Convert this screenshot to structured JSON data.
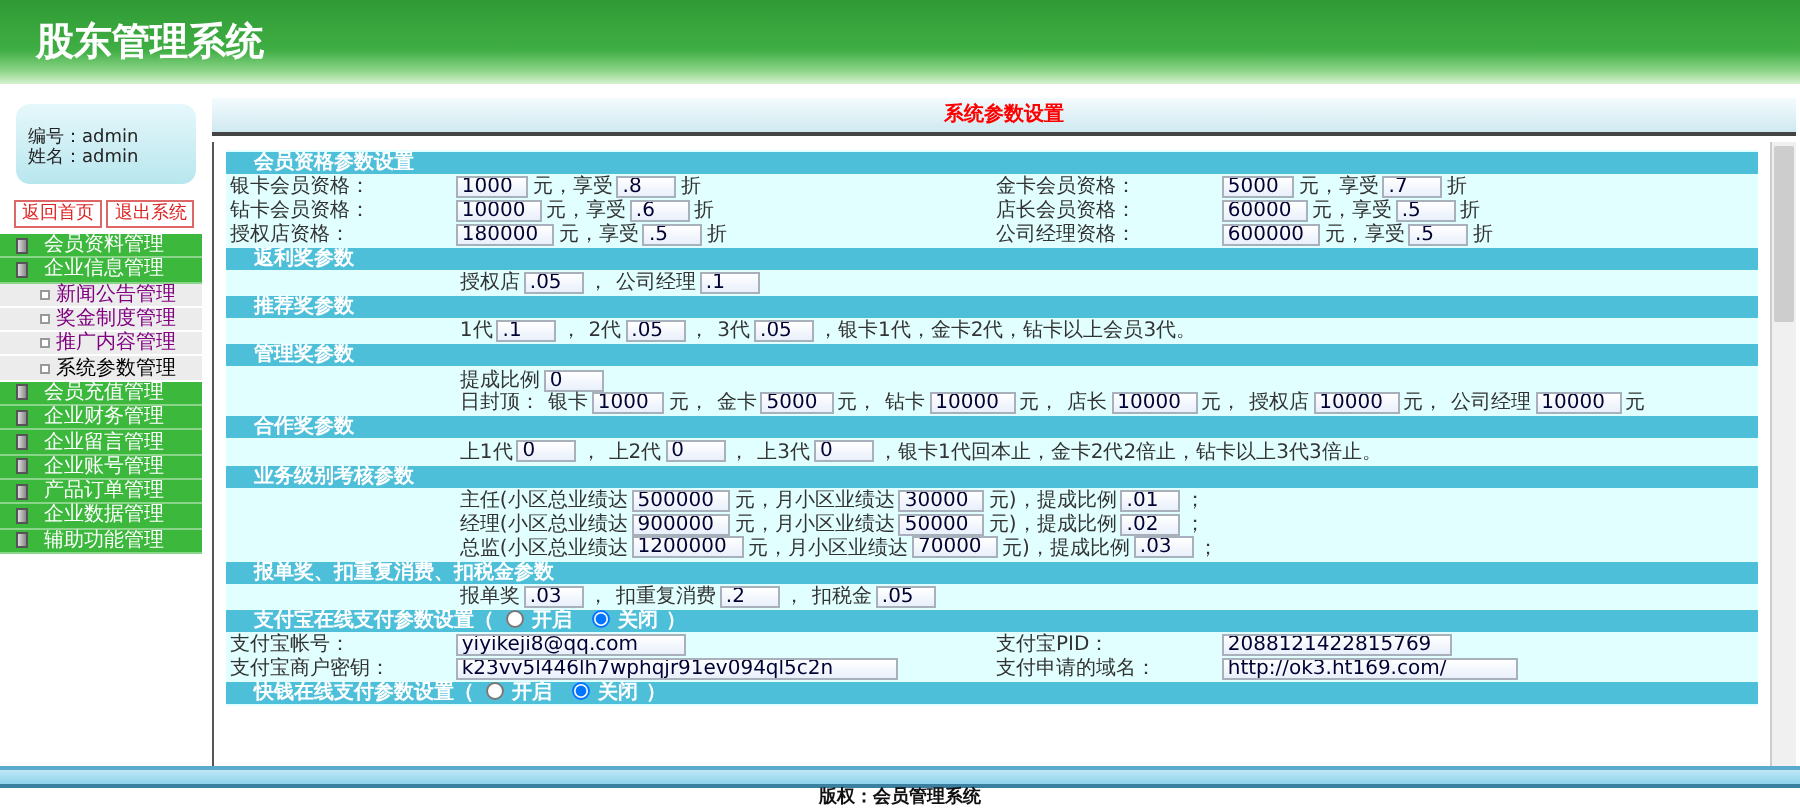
{
  "header": {
    "title": "股东管理系统"
  },
  "sidebar": {
    "user": [
      "编号：admin",
      "姓名：admin"
    ],
    "buttons": [
      "返回首页",
      "退出系统"
    ],
    "menu": [
      {
        "label": "会员资料管理"
      },
      {
        "label": "企业信息管理",
        "children": [
          {
            "label": "新闻公告管理",
            "visited": true
          },
          {
            "label": "奖金制度管理",
            "visited": true
          },
          {
            "label": "推广内容管理",
            "visited": true
          },
          {
            "label": "系统参数管理",
            "visited": false
          }
        ]
      },
      {
        "label": "会员充值管理"
      },
      {
        "label": "企业财务管理"
      },
      {
        "label": "企业留言管理"
      },
      {
        "label": "企业账号管理"
      },
      {
        "label": "产品订单管理"
      },
      {
        "label": "企业数据管理"
      },
      {
        "label": "辅助功能管理"
      }
    ]
  },
  "main": {
    "title": "系统参数设置",
    "sections": [
      {
        "title": "会员资格参数设置",
        "rows": [
          {
            "kind": "pair",
            "cells": [
              {
                "label": "银卡会员资格：",
                "parts": [
                  {
                    "kind": "field",
                    "value": "1000"
                  },
                  {
                    "kind": "text",
                    "text": "元，享受"
                  },
                  {
                    "kind": "field",
                    "value": ".8"
                  },
                  {
                    "kind": "text",
                    "text": "折"
                  }
                ]
              },
              {
                "label": "金卡会员资格：",
                "parts": [
                  {
                    "kind": "field",
                    "value": "5000"
                  },
                  {
                    "kind": "text",
                    "text": "元，享受"
                  },
                  {
                    "kind": "field",
                    "value": ".7"
                  },
                  {
                    "kind": "text",
                    "text": "折"
                  }
                ]
              }
            ]
          },
          {
            "kind": "pair",
            "cells": [
              {
                "label": "钻卡会员资格：",
                "parts": [
                  {
                    "kind": "field",
                    "value": "10000"
                  },
                  {
                    "kind": "text",
                    "text": "元，享受"
                  },
                  {
                    "kind": "field",
                    "value": ".6"
                  },
                  {
                    "kind": "text",
                    "text": "折"
                  }
                ]
              },
              {
                "label": "店长会员资格：",
                "parts": [
                  {
                    "kind": "field",
                    "value": "60000"
                  },
                  {
                    "kind": "text",
                    "text": "元，享受"
                  },
                  {
                    "kind": "field",
                    "value": ".5"
                  },
                  {
                    "kind": "text",
                    "text": "折"
                  }
                ]
              }
            ]
          },
          {
            "kind": "pair",
            "cells": [
              {
                "label": "授权店资格：",
                "parts": [
                  {
                    "kind": "field",
                    "value": "180000"
                  },
                  {
                    "kind": "text",
                    "text": "元，享受"
                  },
                  {
                    "kind": "field",
                    "value": ".5"
                  },
                  {
                    "kind": "text",
                    "text": "折"
                  }
                ]
              },
              {
                "label": "公司经理资格：",
                "parts": [
                  {
                    "kind": "field",
                    "value": "600000"
                  },
                  {
                    "kind": "text",
                    "text": "元，享受"
                  },
                  {
                    "kind": "field",
                    "value": ".5"
                  },
                  {
                    "kind": "text",
                    "text": "折"
                  }
                ]
              }
            ]
          }
        ]
      },
      {
        "title": "返利奖参数",
        "rows": [
          {
            "kind": "line",
            "parts": [
              {
                "kind": "text",
                "text": "授权店"
              },
              {
                "kind": "field",
                "value": ".05"
              },
              {
                "kind": "text",
                "text": "，"
              },
              {
                "kind": "text",
                "text": "公司经理"
              },
              {
                "kind": "field",
                "value": ".1"
              }
            ]
          }
        ]
      },
      {
        "title": "推荐奖参数",
        "rows": [
          {
            "kind": "line",
            "parts": [
              {
                "kind": "text",
                "text": "1代"
              },
              {
                "kind": "field",
                "value": ".1"
              },
              {
                "kind": "text",
                "text": "，"
              },
              {
                "kind": "text",
                "text": "2代"
              },
              {
                "kind": "field",
                "value": ".05"
              },
              {
                "kind": "text",
                "text": "，"
              },
              {
                "kind": "text",
                "text": "3代"
              },
              {
                "kind": "field",
                "value": ".05"
              },
              {
                "kind": "text",
                "text": "，银卡1代，金卡2代，钻卡以上会员3代。"
              }
            ]
          }
        ]
      },
      {
        "title": "管理奖参数",
        "rows": [
          {
            "kind": "line",
            "parts": [
              {
                "kind": "text",
                "text": "提成比例"
              },
              {
                "kind": "field",
                "value": "0"
              }
            ]
          },
          {
            "kind": "line",
            "parts": [
              {
                "kind": "text",
                "text": "日封顶："
              },
              {
                "kind": "text",
                "text": "银卡"
              },
              {
                "kind": "field",
                "value": "1000"
              },
              {
                "kind": "text",
                "text": "元，"
              },
              {
                "kind": "text",
                "text": "金卡"
              },
              {
                "kind": "field",
                "value": "5000"
              },
              {
                "kind": "text",
                "text": "元，"
              },
              {
                "kind": "text",
                "text": "钻卡"
              },
              {
                "kind": "field",
                "value": "10000"
              },
              {
                "kind": "text",
                "text": "元，"
              },
              {
                "kind": "text",
                "text": "店长"
              },
              {
                "kind": "field",
                "value": "10000"
              },
              {
                "kind": "text",
                "text": "元，"
              },
              {
                "kind": "text",
                "text": "授权店"
              },
              {
                "kind": "field",
                "value": "10000"
              },
              {
                "kind": "text",
                "text": "元，"
              },
              {
                "kind": "text",
                "text": "公司经理"
              },
              {
                "kind": "field",
                "value": "10000"
              },
              {
                "kind": "text",
                "text": "元"
              }
            ]
          }
        ]
      },
      {
        "title": "合作奖参数",
        "rows": [
          {
            "kind": "line",
            "parts": [
              {
                "kind": "text",
                "text": "上1代"
              },
              {
                "kind": "field",
                "value": "0"
              },
              {
                "kind": "text",
                "text": "，"
              },
              {
                "kind": "text",
                "text": "上2代"
              },
              {
                "kind": "field",
                "value": "0"
              },
              {
                "kind": "text",
                "text": "，"
              },
              {
                "kind": "text",
                "text": "上3代"
              },
              {
                "kind": "field",
                "value": "0"
              },
              {
                "kind": "text",
                "text": "，银卡1代回本止，金卡2代2倍止，钻卡以上3代3倍止。"
              }
            ]
          }
        ]
      },
      {
        "title": "业务级别考核参数",
        "rows": [
          {
            "kind": "line",
            "parts": [
              {
                "kind": "text",
                "text": "主任(小区总业绩达"
              },
              {
                "kind": "field",
                "value": "500000"
              },
              {
                "kind": "text",
                "text": "元，月小区业绩达"
              },
              {
                "kind": "field",
                "value": "30000"
              },
              {
                "kind": "text",
                "text": "元)，提成比例"
              },
              {
                "kind": "field",
                "value": ".01"
              },
              {
                "kind": "text",
                "text": "；"
              }
            ]
          },
          {
            "kind": "line",
            "parts": [
              {
                "kind": "text",
                "text": "经理(小区总业绩达"
              },
              {
                "kind": "field",
                "value": "900000"
              },
              {
                "kind": "text",
                "text": "元，月小区业绩达"
              },
              {
                "kind": "field",
                "value": "50000"
              },
              {
                "kind": "text",
                "text": "元)，提成比例"
              },
              {
                "kind": "field",
                "value": ".02"
              },
              {
                "kind": "text",
                "text": "；"
              }
            ]
          },
          {
            "kind": "line",
            "parts": [
              {
                "kind": "text",
                "text": "总监(小区总业绩达"
              },
              {
                "kind": "field",
                "value": "1200000"
              },
              {
                "kind": "text",
                "text": "元，月小区业绩达"
              },
              {
                "kind": "field",
                "value": "70000"
              },
              {
                "kind": "text",
                "text": "元)，提成比例"
              },
              {
                "kind": "field",
                "value": ".03"
              },
              {
                "kind": "text",
                "text": "；"
              }
            ]
          }
        ]
      },
      {
        "title": "报单奖、扣重复消费、扣税金参数",
        "rows": [
          {
            "kind": "line",
            "parts": [
              {
                "kind": "text",
                "text": "报单奖"
              },
              {
                "kind": "field",
                "value": ".03"
              },
              {
                "kind": "text",
                "text": "，"
              },
              {
                "kind": "text",
                "text": "扣重复消费"
              },
              {
                "kind": "field",
                "value": ".2"
              },
              {
                "kind": "text",
                "text": "，"
              },
              {
                "kind": "text",
                "text": "扣税金"
              },
              {
                "kind": "field",
                "value": ".05"
              }
            ]
          }
        ]
      },
      {
        "title": "支付宝在线支付参数设置（",
        "radios": [
          {
            "label": "开启",
            "selected": false
          },
          {
            "label": "关闭",
            "selected": true
          }
        ],
        "title_end": "）",
        "rows": [
          {
            "kind": "pair",
            "cells": [
              {
                "label": "支付宝帐号：",
                "parts": [
                  {
                    "kind": "field",
                    "value": "yiyikeji8@qq.com"
                  }
                ]
              },
              {
                "label": "支付宝PID：",
                "parts": [
                  {
                    "kind": "field",
                    "value": "2088121422815769"
                  }
                ]
              }
            ]
          },
          {
            "kind": "pair",
            "cells": [
              {
                "label": "支付宝商户密钥：",
                "parts": [
                  {
                    "kind": "field",
                    "value": "k23vv5l446lh7wphqjr91ev094ql5c2n"
                  }
                ]
              },
              {
                "label": "支付申请的域名：",
                "parts": [
                  {
                    "kind": "field",
                    "value": "http://ok3.ht169.com/"
                  }
                ]
              }
            ]
          }
        ]
      },
      {
        "title": "快钱在线支付参数设置（",
        "radios": [
          {
            "label": "开启",
            "selected": false
          },
          {
            "label": "关闭",
            "selected": true
          }
        ],
        "title_end": "）"
      }
    ]
  },
  "footer": {
    "text": "版权：会员管理系统"
  }
}
